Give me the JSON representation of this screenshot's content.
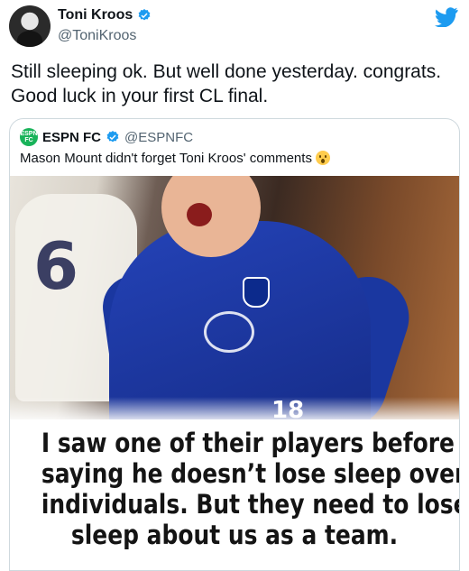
{
  "tweet": {
    "author_name": "Toni Kroos",
    "author_handle": "@ToniKroos",
    "verified": true,
    "text_lines": [
      "Still sleeping ok. But well done yesterday. congrats.",
      "Good luck in your first CL final."
    ]
  },
  "quoted_tweet": {
    "author_name": "ESPN FC",
    "author_handle": "@ESPNFC",
    "avatar_text": "ESPN FC",
    "text": "Mason Mount didn't forget Toni Kroos' comments",
    "emoji": "astonished-face",
    "image": {
      "jersey_number": "18",
      "background_number": "6",
      "quote_lines": [
        "I saw one of their players before",
        "saying he doesn’t lose sleep over",
        "individuals. But they need to lose",
        "sleep about us as a team."
      ]
    }
  },
  "icons": [
    "avatar",
    "verified-badge-icon",
    "twitter-bird-icon",
    "espn-fc-logo",
    "astonished-emoji-icon"
  ],
  "colors": {
    "verified": "#1d9bf0",
    "twitter": "#1d9bf0",
    "espn": "#19b35a",
    "muted": "#536471"
  }
}
